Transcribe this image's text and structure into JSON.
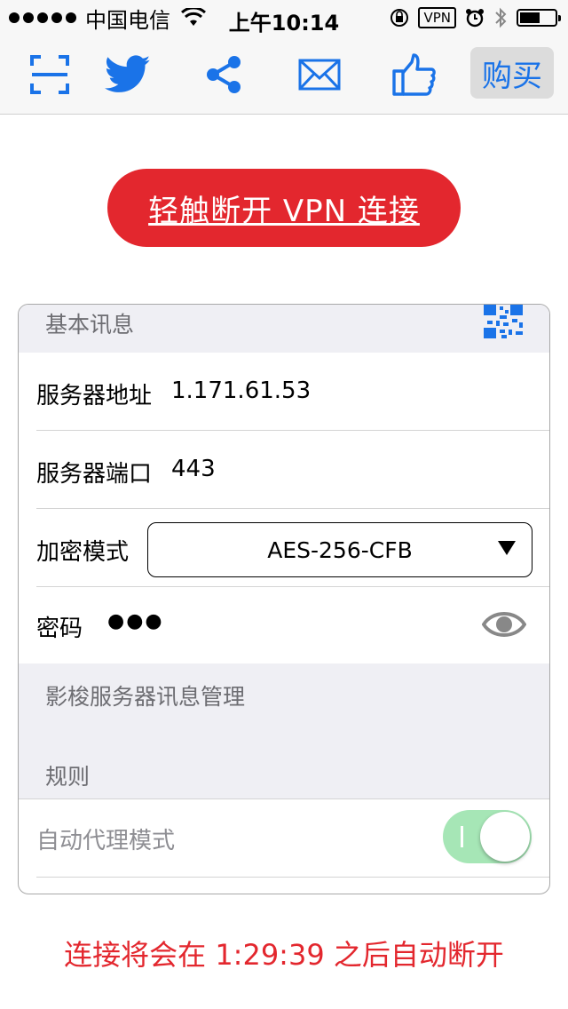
{
  "status_bar": {
    "carrier": "中国电信",
    "time": "上午10:14",
    "vpn_badge": "VPN"
  },
  "toolbar": {
    "icons": [
      "scan-icon",
      "twitter-icon",
      "share-icon",
      "mail-icon",
      "thumbs-up-icon"
    ],
    "buy_label": "购买"
  },
  "disconnect_button": {
    "label": "轻触断开 VPN 连接",
    "color": "#e3272e"
  },
  "basic_info": {
    "header": "基本讯息",
    "server_address_label": "服务器地址",
    "server_address_value": "1.171.61.53",
    "server_port_label": "服务器端口",
    "server_port_value": "443",
    "encryption_label": "加密模式",
    "encryption_value": "AES-256-CFB",
    "password_label": "密码",
    "password_value": "●●●"
  },
  "manage_header": "影梭服务器讯息管理",
  "rules": {
    "header": "规则",
    "auto_proxy_label": "自动代理模式",
    "auto_proxy_on": true
  },
  "countdown": "连接将会在 1:29:39 之后自动断开",
  "colors": {
    "accent": "#1a73e8",
    "danger": "#e3272e",
    "toggle_on": "#a6e6b6"
  }
}
